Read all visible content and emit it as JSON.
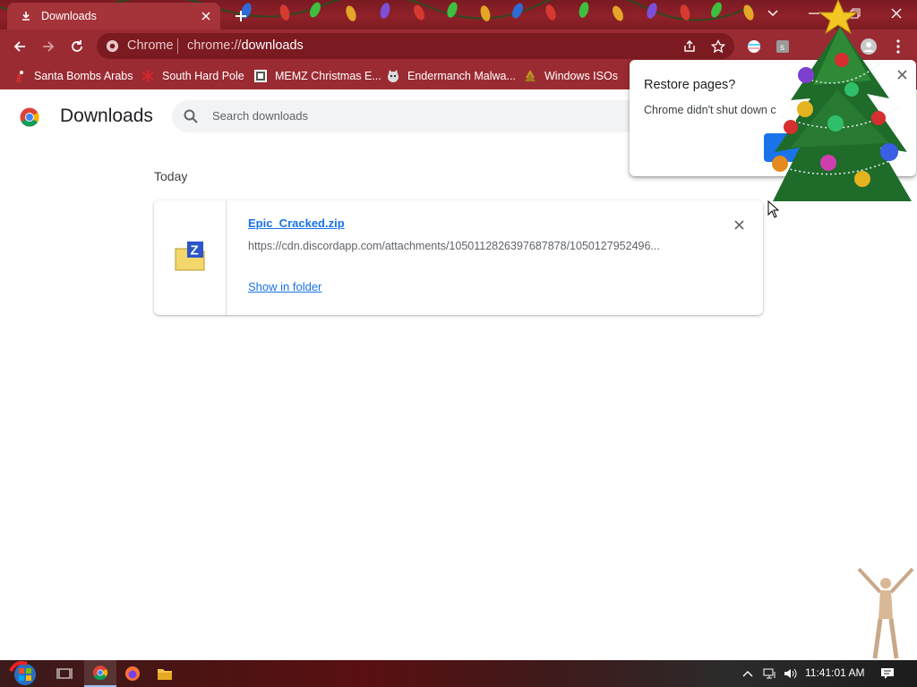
{
  "browser": {
    "tab": {
      "title": "Downloads",
      "icon": "download-icon"
    },
    "omnibox": {
      "origin_label": "Chrome",
      "url_scheme": "chrome://",
      "url_host": "downloads"
    },
    "bookmarks": [
      {
        "label": "Santa Bombs Arabs",
        "icon": "santa-icon"
      },
      {
        "label": "South Hard Pole",
        "icon": "snowflake-icon"
      },
      {
        "label": "MEMZ Christmas E...",
        "icon": "memz-icon"
      },
      {
        "label": "Endermanch Malwa...",
        "icon": "cat-icon"
      },
      {
        "label": "Windows ISOs",
        "icon": "tree-icon"
      }
    ],
    "accent": "#9b2b33"
  },
  "page": {
    "title": "Downloads",
    "search_placeholder": "Search downloads",
    "section_label": "Today",
    "download": {
      "file_name": "Epic_Cracked.zip",
      "url": "https://cdn.discordapp.com/attachments/1050112826397687878/1050127952496...",
      "action_label": "Show in folder"
    }
  },
  "restore_popup": {
    "title": "Restore pages?",
    "message": "Chrome didn't shut down c"
  },
  "taskbar": {
    "clock": "11:41:01 AM"
  }
}
